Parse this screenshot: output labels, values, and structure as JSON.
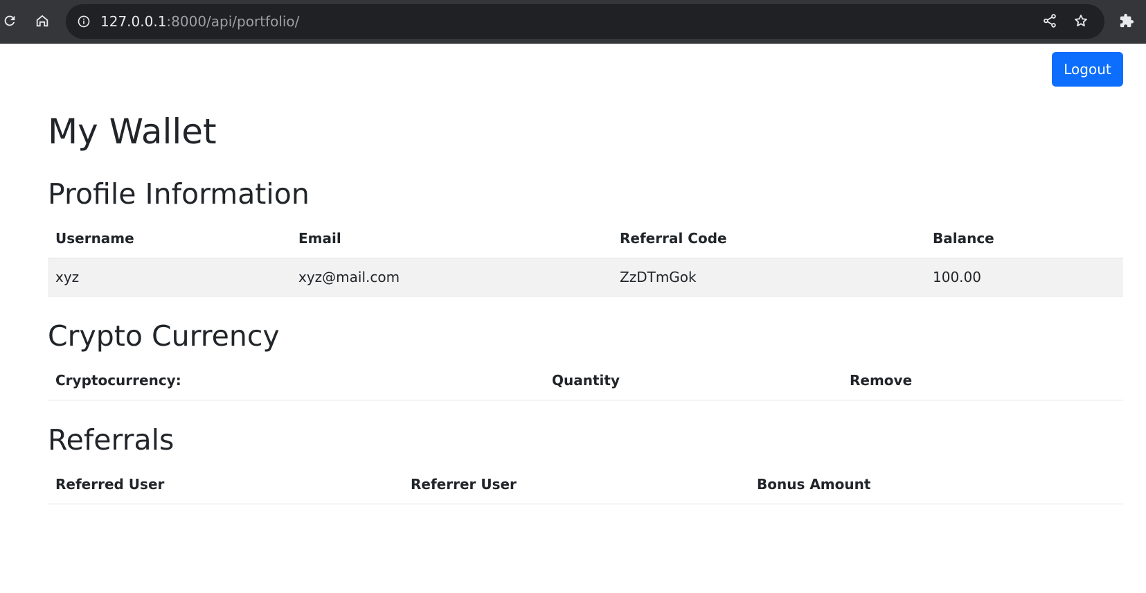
{
  "browser": {
    "url_host": "127.0.0.1",
    "url_rest": ":8000/api/portfolio/",
    "icons": [
      "reload-icon",
      "home-icon",
      "info-icon",
      "share-icon",
      "star-icon",
      "extensions-icon"
    ]
  },
  "header": {
    "logout_label": "Logout"
  },
  "page": {
    "title": "My Wallet"
  },
  "profile": {
    "heading": "Profile Information",
    "columns": [
      "Username",
      "Email",
      "Referral Code",
      "Balance"
    ],
    "row": {
      "username": "xyz",
      "email": "xyz@mail.com",
      "referral_code": "ZzDTmGok",
      "balance": "100.00"
    }
  },
  "crypto": {
    "heading": "Crypto Currency",
    "columns": [
      "Cryptocurrency:",
      "Quantity",
      "Remove"
    ]
  },
  "referrals": {
    "heading": "Referrals",
    "columns": [
      "Referred User",
      "Referrer User",
      "Bonus Amount"
    ]
  },
  "colors": {
    "toolbar": "#35363a",
    "omnibox": "#202124",
    "primary": "#0d6efd",
    "striped_row": "#f2f2f2"
  }
}
